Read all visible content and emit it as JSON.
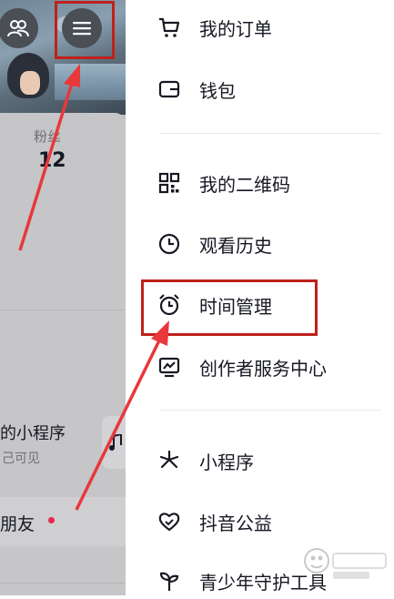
{
  "profile": {
    "fans_label": "粉丝",
    "fans_count": "12",
    "mini_program_title": "的小程序",
    "mini_program_subtitle": "己可见",
    "friends_label": "朋友"
  },
  "menu": {
    "items": [
      {
        "label": "我的订单",
        "icon": "cart-icon"
      },
      {
        "label": "钱包",
        "icon": "wallet-icon"
      },
      {
        "label": "我的二维码",
        "icon": "qr-code-icon"
      },
      {
        "label": "观看历史",
        "icon": "clock-icon"
      },
      {
        "label": "时间管理",
        "icon": "alarm-clock-icon"
      },
      {
        "label": "创作者服务中心",
        "icon": "chart-monitor-icon"
      },
      {
        "label": "小程序",
        "icon": "asterisk-icon"
      },
      {
        "label": "抖音公益",
        "icon": "heart-icon"
      },
      {
        "label": "青少年守护工具",
        "icon": "sprout-icon"
      }
    ]
  },
  "colors": {
    "highlight": "#c0201c",
    "arrow": "#e8383c",
    "notification_dot": "#e8284c"
  }
}
